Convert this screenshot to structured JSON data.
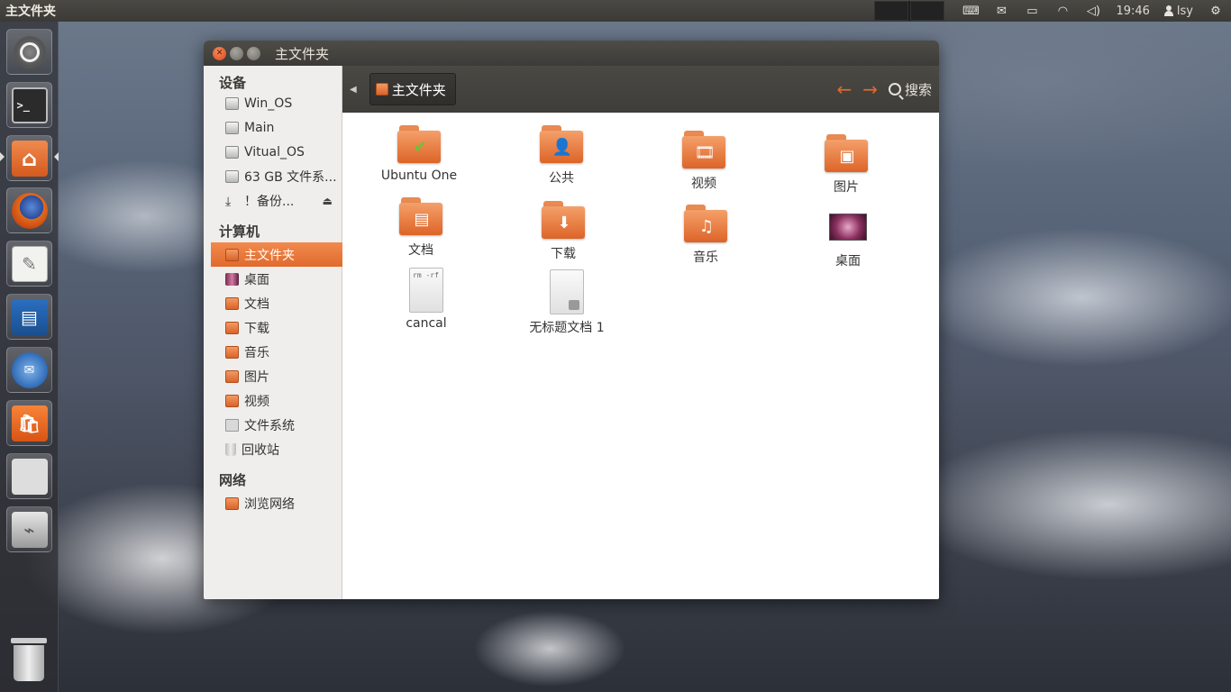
{
  "top_panel": {
    "app_title": "主文件夹",
    "clock": "19:46",
    "user": "lsy",
    "tray_icons": [
      "keyboard-icon",
      "mail-icon",
      "battery-icon",
      "wifi-icon",
      "volume-icon",
      "gear-icon"
    ]
  },
  "launcher": {
    "items": [
      "ubuntu-dash",
      "terminal",
      "home-folder",
      "firefox",
      "text-editor",
      "libreoffice-writer",
      "thunderbird",
      "software-center",
      "workspace-switcher",
      "usb-drive"
    ],
    "trash": "trash-icon"
  },
  "window": {
    "title": "主文件夹",
    "sidebar": {
      "devices_header": "设备",
      "devices": [
        {
          "label": "Win_OS",
          "icon": "drive-icon"
        },
        {
          "label": "Main",
          "icon": "drive-icon"
        },
        {
          "label": "Vitual_OS",
          "icon": "drive-icon"
        },
        {
          "label": "63 GB 文件系...",
          "icon": "drive-icon"
        },
        {
          "label": "！备份...",
          "icon": "download-drive-icon"
        }
      ],
      "computer_header": "计算机",
      "places": [
        {
          "label": "主文件夹",
          "icon": "home-folder-icon",
          "active": true
        },
        {
          "label": "桌面",
          "icon": "desktop-icon"
        },
        {
          "label": "文档",
          "icon": "documents-folder-icon"
        },
        {
          "label": "下载",
          "icon": "downloads-folder-icon"
        },
        {
          "label": "音乐",
          "icon": "music-folder-icon"
        },
        {
          "label": "图片",
          "icon": "pictures-folder-icon"
        },
        {
          "label": "视频",
          "icon": "videos-folder-icon"
        },
        {
          "label": "文件系统",
          "icon": "filesystem-icon"
        },
        {
          "label": "回收站",
          "icon": "trash-icon"
        }
      ],
      "network_header": "网络",
      "network": [
        {
          "label": "浏览网络",
          "icon": "network-folder-icon"
        }
      ]
    },
    "toolbar": {
      "path_button": "主文件夹",
      "search_label": "搜索"
    },
    "files": [
      {
        "name": "Ubuntu One",
        "icon": "ubuntu-one-folder-icon"
      },
      {
        "name": "公共",
        "icon": "public-folder-icon"
      },
      {
        "name": "视频",
        "icon": "videos-folder-icon"
      },
      {
        "name": "图片",
        "icon": "pictures-folder-icon"
      },
      {
        "name": "文档",
        "icon": "documents-folder-icon"
      },
      {
        "name": "下载",
        "icon": "downloads-folder-icon"
      },
      {
        "name": "音乐",
        "icon": "music-folder-icon"
      },
      {
        "name": "桌面",
        "icon": "desktop-icon"
      },
      {
        "name": "cancal",
        "icon": "script-file-icon"
      },
      {
        "name": "无标题文档 1",
        "icon": "locked-document-icon"
      }
    ]
  },
  "colors": {
    "accent": "#e06a2c",
    "panel": "#3c3b37",
    "sidebar_bg": "#efeeec"
  }
}
